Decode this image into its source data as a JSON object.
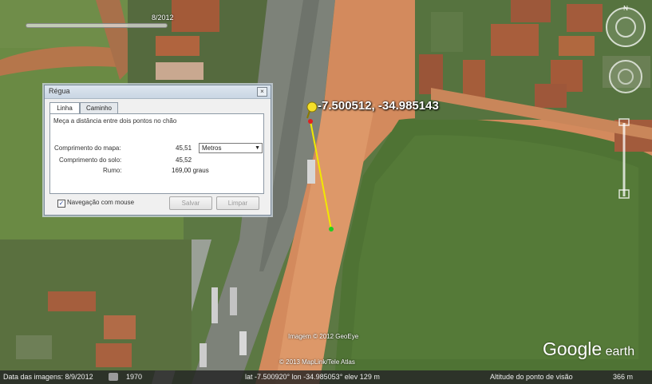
{
  "timeline": {
    "label": "8/2012"
  },
  "dialog": {
    "title": "Régua",
    "tabs": [
      "Linha",
      "Caminho"
    ],
    "instruction": "Meça a distância entre dois pontos no chão",
    "map_length_label": "Comprimento do mapa:",
    "map_length_value": "45,51",
    "unit_selected": "Metros",
    "ground_length_label": "Comprimento do solo:",
    "ground_length_value": "45,52",
    "heading_label": "Rumo:",
    "heading_value": "169,00 graus",
    "mouse_nav_label": "Navegação com mouse",
    "mouse_nav_checked": true,
    "save_label": "Salvar",
    "clear_label": "Limpar"
  },
  "placemark": {
    "coords": "-7.500512, -34.985143"
  },
  "credits": {
    "imagery": "Imagem © 2012 GeoEye",
    "data": "© 2013 MapLink/Tele Atlas"
  },
  "logo": {
    "google": "Google",
    "earth": "earth"
  },
  "status_bar": {
    "imagery_date": "Data das imagens: 8/9/2012",
    "year": "1970",
    "position": "lat  -7.500920°  lon  -34.985053°  elev   129 m",
    "eye_alt_label": "Altitude do ponto de visão",
    "eye_alt_value": "366 m"
  },
  "compass": {
    "north": "N"
  },
  "colors": {
    "ruler_line": "#f2e800",
    "end_point": "#22cc22",
    "start_point": "#e02020",
    "dialog_bg": "#f0f0f0"
  },
  "icons": [
    "yellow-pushpin-icon",
    "compass-icon",
    "look-joystick-icon",
    "move-joystick-icon",
    "zoom-slider-icon",
    "close-icon",
    "dropdown-arrow-icon",
    "checkbox-icon"
  ]
}
